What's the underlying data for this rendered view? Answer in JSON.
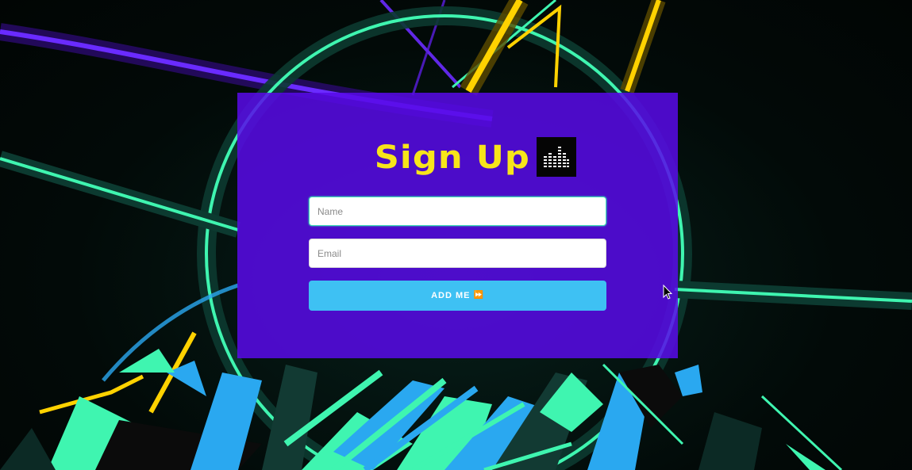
{
  "form": {
    "title": "Sign Up",
    "title_icon": "equalizer-icon",
    "name_placeholder": "Name",
    "email_placeholder": "Email",
    "submit_label": "ADD ME",
    "submit_icon": "fast-forward-icon"
  },
  "colors": {
    "card_background": "#580ae8",
    "title": "#f7e51a",
    "button": "#3ec1f3",
    "neon_green": "#3ff5b0",
    "neon_yellow": "#ffd200",
    "neon_purple": "#6a2bff",
    "neon_blue": "#2aa8f0"
  }
}
